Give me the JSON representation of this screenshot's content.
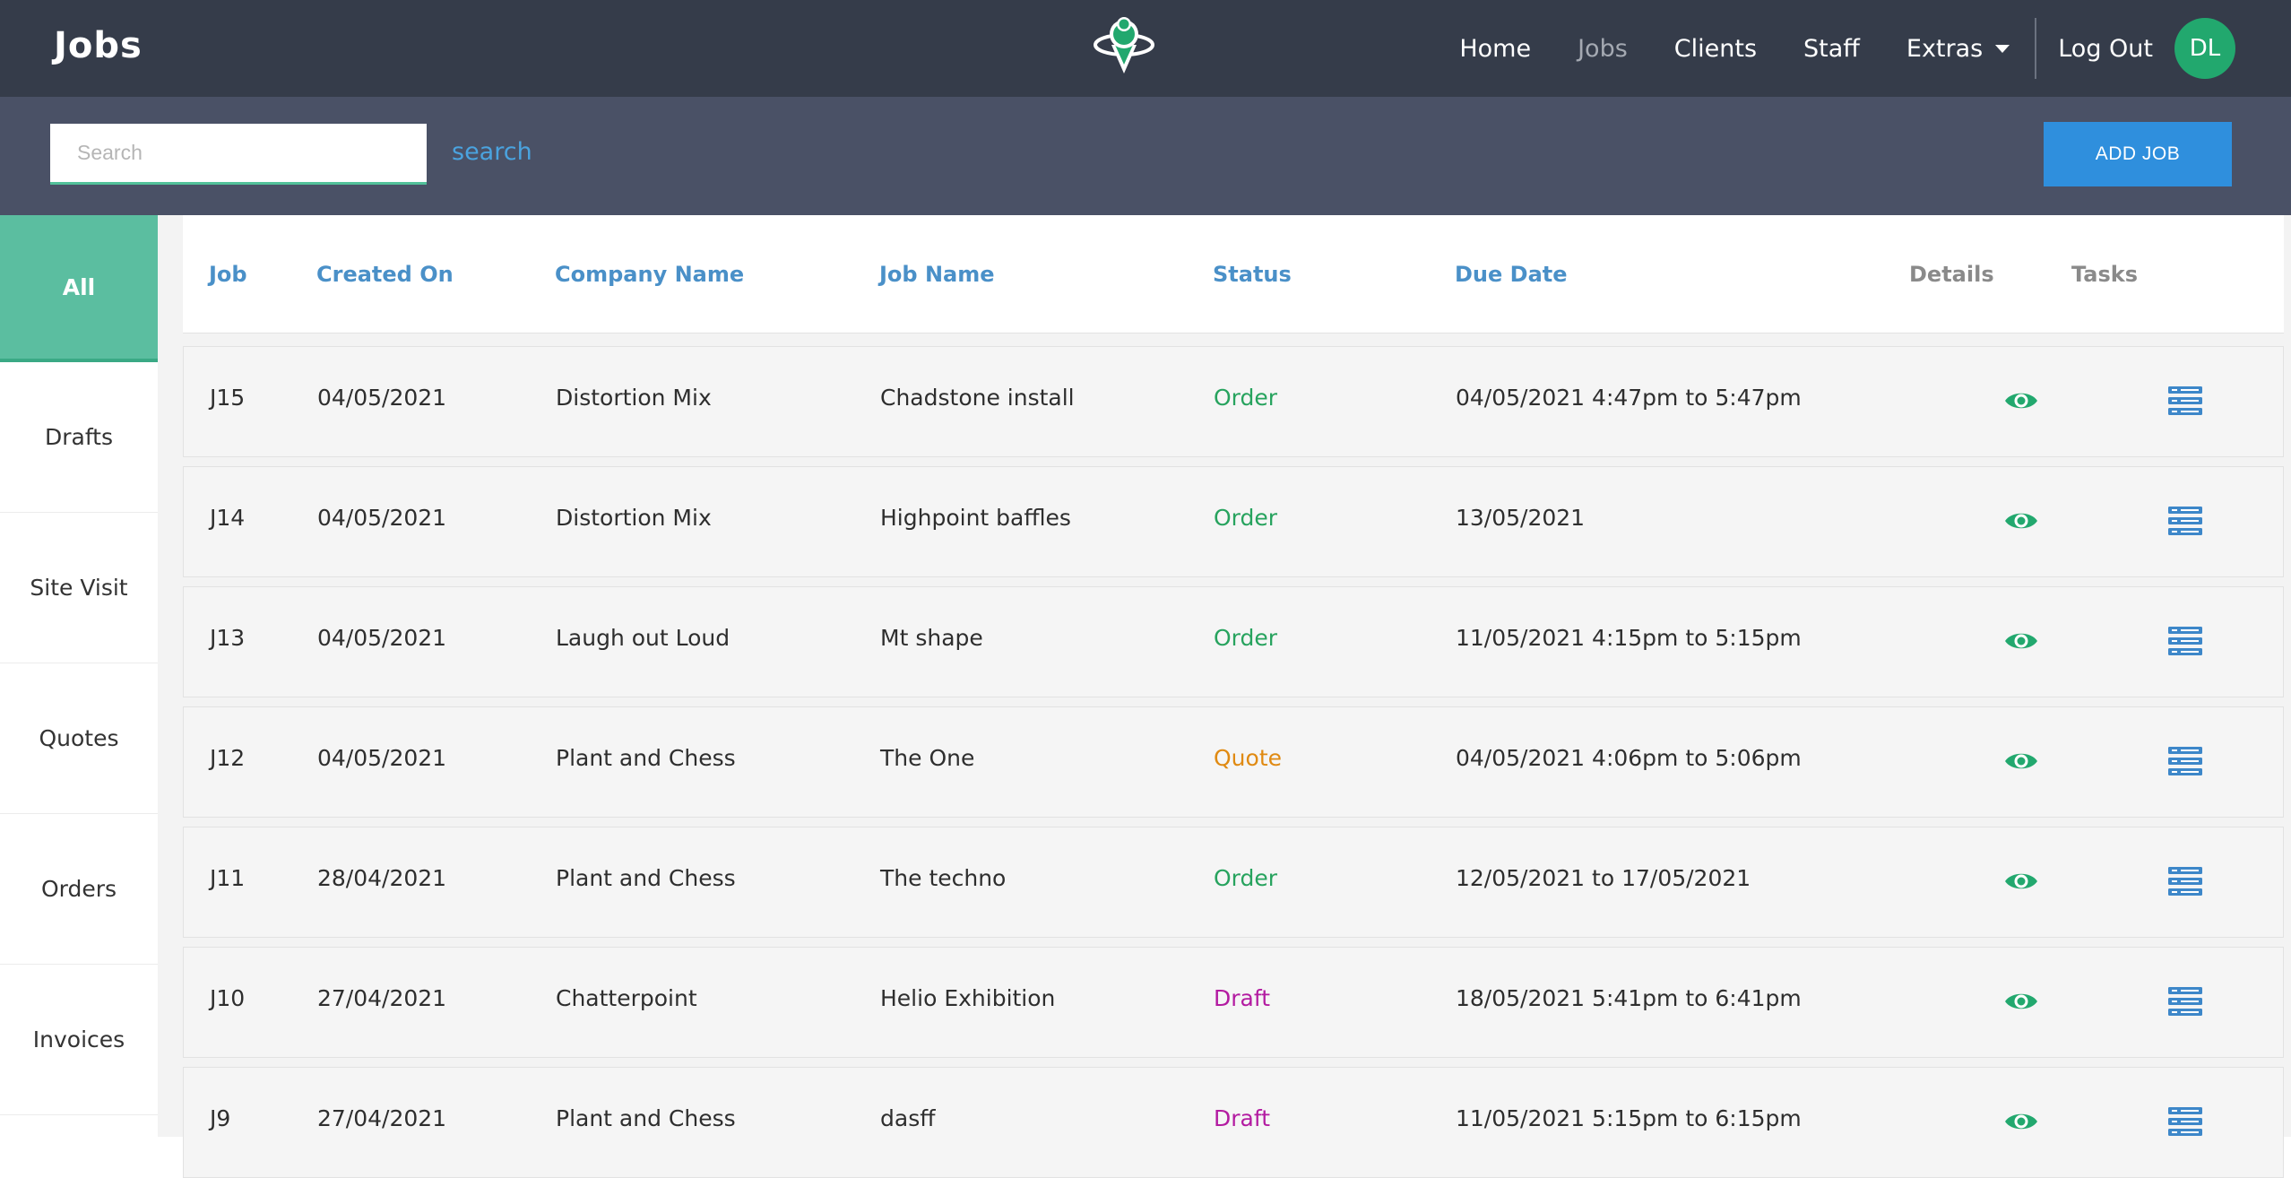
{
  "header": {
    "title": "Jobs",
    "logo_icon": "map-pin-orbit-icon",
    "nav": [
      {
        "label": "Home",
        "active": false
      },
      {
        "label": "Jobs",
        "active": true
      },
      {
        "label": "Clients",
        "active": false
      },
      {
        "label": "Staff",
        "active": false
      },
      {
        "label": "Extras",
        "active": false
      }
    ],
    "logout_label": "Log Out",
    "avatar_initials": "DL",
    "avatar_color": "#22a86e"
  },
  "toolbar": {
    "search_placeholder": "Search",
    "search_value": "",
    "search_link": "search",
    "add_job_label": "ADD JOB",
    "accent": "#2f8fdd"
  },
  "sidebar": {
    "items": [
      {
        "label": "All",
        "active": true
      },
      {
        "label": "Drafts",
        "active": false
      },
      {
        "label": "Site Visit",
        "active": false
      },
      {
        "label": "Quotes",
        "active": false
      },
      {
        "label": "Orders",
        "active": false
      },
      {
        "label": "Invoices",
        "active": false
      }
    ],
    "active_color": "#5bbea0"
  },
  "table": {
    "columns": [
      "Job",
      "Created On",
      "Company Name",
      "Job Name",
      "Status",
      "Due Date",
      "Details",
      "Tasks"
    ],
    "rows": [
      {
        "job": "J15",
        "created": "04/05/2021",
        "company": "Distortion Mix",
        "name": "Chadstone install",
        "status": "Order",
        "due": "04/05/2021 4:47pm to 5:47pm"
      },
      {
        "job": "J14",
        "created": "04/05/2021",
        "company": "Distortion Mix",
        "name": "Highpoint baffles",
        "status": "Order",
        "due": "13/05/2021"
      },
      {
        "job": "J13",
        "created": "04/05/2021",
        "company": "Laugh out Loud",
        "name": "Mt shape",
        "status": "Order",
        "due": "11/05/2021 4:15pm to 5:15pm"
      },
      {
        "job": "J12",
        "created": "04/05/2021",
        "company": "Plant and Chess",
        "name": "The One",
        "status": "Quote",
        "due": "04/05/2021 4:06pm to 5:06pm"
      },
      {
        "job": "J11",
        "created": "28/04/2021",
        "company": "Plant and Chess",
        "name": "The techno",
        "status": "Order",
        "due": "12/05/2021 to 17/05/2021"
      },
      {
        "job": "J10",
        "created": "27/04/2021",
        "company": "Chatterpoint",
        "name": "Helio Exhibition",
        "status": "Draft",
        "due": "18/05/2021 5:41pm to 6:41pm"
      },
      {
        "job": "J9",
        "created": "27/04/2021",
        "company": "Plant and Chess",
        "name": "dasff",
        "status": "Draft",
        "due": "11/05/2021 5:15pm to 6:15pm"
      }
    ],
    "status_colors": {
      "Order": "#27a35e",
      "Quote": "#e08a12",
      "Draft": "#b31ba1"
    },
    "details_icon": "eye-icon",
    "tasks_icon": "task-list-icon"
  }
}
